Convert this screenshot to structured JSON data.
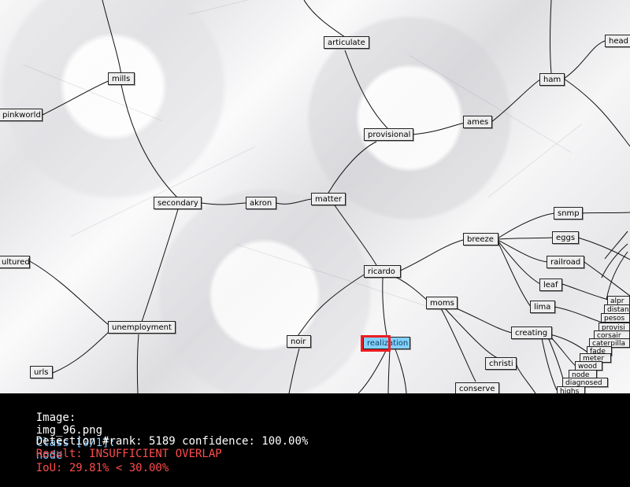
{
  "diagram": {
    "nodes": [
      {
        "id": "articulate",
        "label": "articulate"
      },
      {
        "id": "head",
        "label": "head"
      },
      {
        "id": "mills",
        "label": "mills"
      },
      {
        "id": "ham",
        "label": "ham"
      },
      {
        "id": "pinkworld",
        "label": "pinkworld"
      },
      {
        "id": "ames",
        "label": "ames"
      },
      {
        "id": "provisional",
        "label": "provisional"
      },
      {
        "id": "secondary",
        "label": "secondary"
      },
      {
        "id": "akron",
        "label": "akron"
      },
      {
        "id": "matter",
        "label": "matter"
      },
      {
        "id": "snmp",
        "label": "snmp"
      },
      {
        "id": "eggs",
        "label": "eggs"
      },
      {
        "id": "breeze",
        "label": "breeze"
      },
      {
        "id": "cultured",
        "label": "ultured"
      },
      {
        "id": "ricardo",
        "label": "ricardo"
      },
      {
        "id": "railroad",
        "label": "railroad"
      },
      {
        "id": "leaf",
        "label": "leaf"
      },
      {
        "id": "moms",
        "label": "moms"
      },
      {
        "id": "lima",
        "label": "lima"
      },
      {
        "id": "unemployment",
        "label": "unemployment"
      },
      {
        "id": "creating",
        "label": "creating"
      },
      {
        "id": "noir",
        "label": "noir"
      },
      {
        "id": "realization",
        "label": "realization"
      },
      {
        "id": "christi",
        "label": "christi"
      },
      {
        "id": "urls",
        "label": "urls"
      },
      {
        "id": "conserve",
        "label": "conserve"
      },
      {
        "id": "alpr",
        "label": "alpr"
      },
      {
        "id": "distan",
        "label": "distan"
      },
      {
        "id": "pesos",
        "label": "pesos"
      },
      {
        "id": "provisi",
        "label": "provisi"
      },
      {
        "id": "corsair",
        "label": "corsair"
      },
      {
        "id": "caterpilla",
        "label": "caterpilla"
      },
      {
        "id": "fade",
        "label": "fade"
      },
      {
        "id": "meter",
        "label": "meter"
      },
      {
        "id": "wood",
        "label": "wood"
      },
      {
        "id": "node",
        "label": "node"
      },
      {
        "id": "diagnosed",
        "label": "diagnosed"
      },
      {
        "id": "highs",
        "label": "highs"
      }
    ]
  },
  "status": {
    "image_label": "Image:",
    "image_name": "img_96.png",
    "class_text": "Class [0/1]:",
    "class_value": "node",
    "iou_text": "IoU: 29.81% < 30.00%",
    "rank_text": "Detection #rank: 5189 confidence: 100.00%",
    "result_text": "Result: INSUFFICIENT OVERLAP"
  },
  "colors": {
    "highlight": "#83d0ff",
    "detection_box": "#ee1d23",
    "status_blue": "#7fc9ff",
    "status_red": "#ff4c4c"
  }
}
